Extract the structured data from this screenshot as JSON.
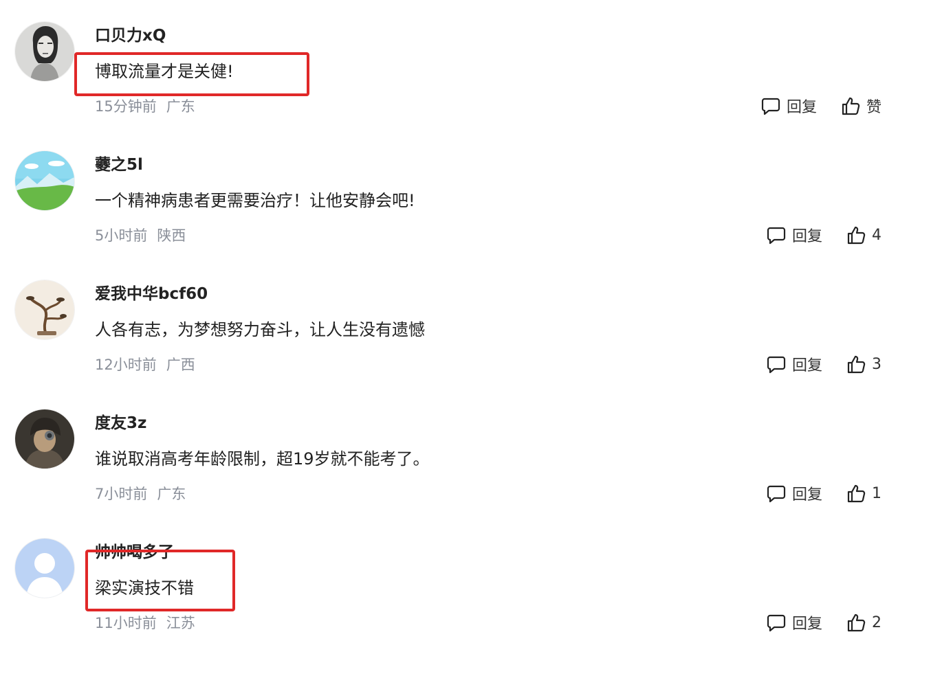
{
  "comments": [
    {
      "username": "口贝力xQ",
      "text": "博取流量才是关健!",
      "time": "15分钟前",
      "location": "广东",
      "reply_label": "回复",
      "like_label": "赞",
      "avatar": "portrait-sketch-avatar",
      "highlighted": true
    },
    {
      "username": "虁之5l",
      "text": "一个精神病患者更需要治疗！让他安静会吧!",
      "time": "5小时前",
      "location": "陕西",
      "reply_label": "回复",
      "like_label": "4",
      "avatar": "landscape-avatar",
      "highlighted": false
    },
    {
      "username": "爱我中华bcf60",
      "text": "人各有志，为梦想努力奋斗，让人生没有遗憾",
      "time": "12小时前",
      "location": "广西",
      "reply_label": "回复",
      "like_label": "3",
      "avatar": "bonsai-avatar",
      "highlighted": false
    },
    {
      "username": "度友3z",
      "text": "谁说取消高考年龄限制，超19岁就不能考了。",
      "time": "7小时前",
      "location": "广东",
      "reply_label": "回复",
      "like_label": "1",
      "avatar": "helmet-avatar",
      "highlighted": false
    },
    {
      "username": "帅帅喝多了",
      "text": "梁实演技不错",
      "time": "11小时前",
      "location": "江苏",
      "reply_label": "回复",
      "like_label": "2",
      "avatar": "default-user-avatar",
      "highlighted": true
    }
  ],
  "colors": {
    "highlight": "#e02828",
    "meta_text": "#8a8f99",
    "main_text": "#222222"
  }
}
